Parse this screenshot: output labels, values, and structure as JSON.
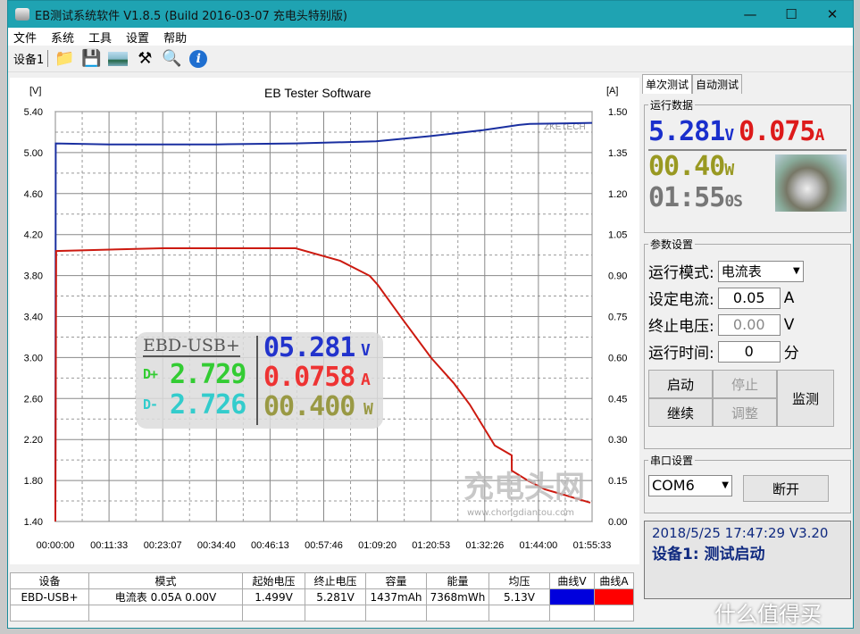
{
  "window": {
    "title": "EB测试系统软件 V1.8.5 (Build 2016-03-07 充电头特别版)"
  },
  "menu": [
    "文件",
    "系统",
    "工具",
    "设置",
    "帮助"
  ],
  "toolbar": {
    "device": "设备1",
    "icons": [
      "folder-icon",
      "save-icon",
      "image-icon",
      "tools-icon",
      "search-icon",
      "info-icon"
    ]
  },
  "chart_data": {
    "type": "line",
    "title": "EB Tester Software",
    "ylabel_left": "[V]",
    "ylabel_right": "[A]",
    "watermark": "ZKETECH",
    "ylim_left": [
      1.4,
      5.4
    ],
    "ylim_right": [
      0,
      1.5
    ],
    "yticks_left": [
      "5.40",
      "5.00",
      "4.60",
      "4.20",
      "3.80",
      "3.40",
      "3.00",
      "2.60",
      "2.20",
      "1.80",
      "1.40"
    ],
    "yticks_right": [
      "1.50",
      "1.35",
      "1.20",
      "1.05",
      "0.90",
      "0.75",
      "0.60",
      "0.45",
      "0.30",
      "0.15",
      "0.00"
    ],
    "xticks": [
      "00:00:00",
      "00:11:33",
      "00:23:07",
      "00:34:40",
      "00:46:13",
      "00:57:46",
      "01:09:20",
      "01:20:53",
      "01:32:26",
      "01:44:00",
      "01:55:33"
    ],
    "grid": true,
    "series": [
      {
        "name": "曲线V",
        "axis": "left",
        "color": "#1a2fa0",
        "x": [
          "00:00:00",
          "00:00:05",
          "00:11:33",
          "00:34:40",
          "00:51:43",
          "01:09:01",
          "01:20:34",
          "01:32:05",
          "01:39:48",
          "01:42:07",
          "01:55:33"
        ],
        "y": [
          1.4,
          5.09,
          5.08,
          5.08,
          5.09,
          5.11,
          5.16,
          5.22,
          5.27,
          5.28,
          5.29
        ]
      },
      {
        "name": "曲线A",
        "axis": "right",
        "color": "#cc1a10",
        "x": [
          "00:00:00",
          "00:00:10",
          "00:23:07",
          "00:46:13",
          "00:51:43",
          "01:01:20",
          "01:07:41",
          "01:09:24",
          "01:14:48",
          "01:20:57",
          "01:25:45",
          "01:29:13",
          "01:32:29",
          "01:34:36",
          "01:38:15",
          "01:38:16",
          "01:41:42",
          "01:45:22",
          "01:49:24",
          "01:55:10"
        ],
        "y": [
          0,
          0.99,
          1.0,
          1.0,
          1.0,
          0.954,
          0.899,
          0.866,
          0.739,
          0.598,
          0.507,
          0.428,
          0.337,
          0.278,
          0.242,
          0.186,
          0.15,
          0.118,
          0.098,
          0.069
        ]
      }
    ]
  },
  "overlay": {
    "model": "EBD-USB+",
    "voltage": "05.281",
    "v_unit": "V",
    "dplus_label": "D+",
    "dplus": "2.729",
    "current": "0.0758",
    "a_unit": "A",
    "dminus_label": "D-",
    "dminus": "2.726",
    "power": "00.400",
    "w_unit": "W"
  },
  "watermark2": {
    "logo": "充电头网",
    "url": "www.chongdiantou.com"
  },
  "table": {
    "headers": [
      "设备",
      "模式",
      "起始电压",
      "终止电压",
      "容量",
      "能量",
      "均压",
      "曲线V",
      "曲线A"
    ],
    "rows": [
      [
        "EBD-USB+",
        "电流表  0.05A  0.00V",
        "1.499V",
        "5.281V",
        "1437mAh",
        "7368mWh",
        "5.13V",
        "",
        ""
      ]
    ],
    "curve_colors": [
      "#0000dd",
      "#ff0000"
    ]
  },
  "right": {
    "tabs": [
      "单次测试",
      "自动测试"
    ],
    "run_data": {
      "label": "运行数据",
      "voltage": "5.281",
      "v_unit": "V",
      "current": "0.075",
      "a_unit": "A",
      "power": "00.40",
      "w_unit": "W",
      "time": "01:55",
      "time_unit": "0S"
    },
    "params": {
      "label": "参数设置",
      "mode_label": "运行模式:",
      "mode": "电流表",
      "current_label": "设定电流:",
      "current": "0.05",
      "current_unit": "A",
      "stopv_label": "终止电压:",
      "stopv": "0.00",
      "stopv_unit": "V",
      "time_label": "运行时间:",
      "time": "0",
      "time_unit": "分"
    },
    "buttons": {
      "start": "启动",
      "stop": "停止",
      "monitor": "监测",
      "resume": "继续",
      "adjust": "调整"
    },
    "serial": {
      "label": "串口设置",
      "port": "COM6",
      "disconnect": "断开"
    },
    "status": {
      "line1": "2018/5/25 17:47:29  V3.20",
      "line2": "设备1: 测试启动"
    }
  },
  "site_watermark": "什么值得买"
}
